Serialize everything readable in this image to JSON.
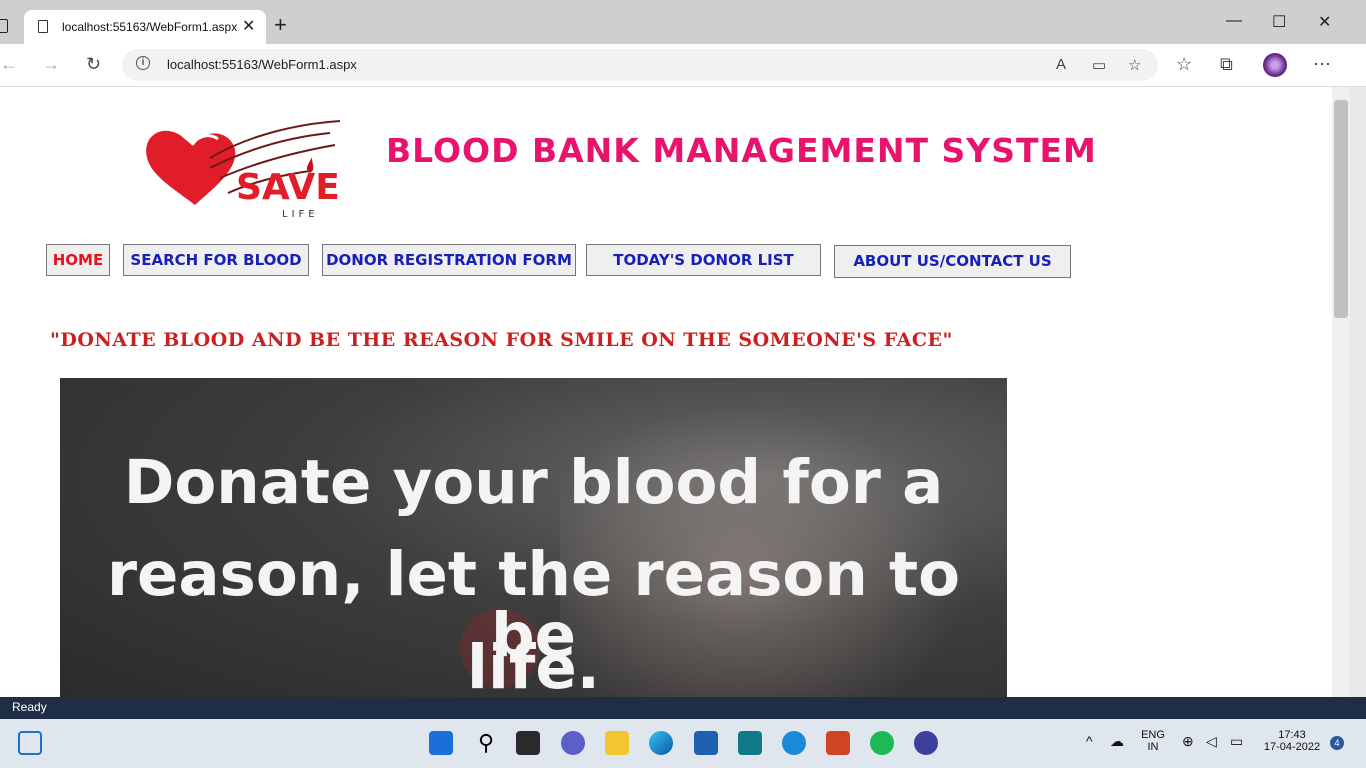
{
  "browser": {
    "tab_title": "localhost:55163/WebForm1.aspx",
    "tab_close": "✕",
    "new_tab": "+",
    "url": "localhost:55163/WebForm1.aspx",
    "window_controls": [
      "—",
      "☐",
      "✕"
    ]
  },
  "site": {
    "logo_text": "SAVE",
    "logo_subtext": "LIFE",
    "title": "BLOOD BANK MANAGEMENT SYSTEM",
    "menu": [
      {
        "label": "HOME",
        "color": "#e8131f"
      },
      {
        "label": "SEARCH FOR BLOOD",
        "color": "#1720b8"
      },
      {
        "label": "DONOR REGISTRATION FORM",
        "color": "#1720b8"
      },
      {
        "label": "TODAY'S DONOR LIST",
        "color": "#1720b8"
      },
      {
        "label": "ABOUT US/CONTACT US",
        "color": "#1720b8"
      }
    ],
    "tagline": "\"DONATE BLOOD AND BE THE REASON FOR SMILE ON THE SOMEONE'S FACE\"",
    "banner_lines": [
      "Donate your blood for a",
      "reason, let the reason to be",
      "life."
    ]
  },
  "status": {
    "text": "Ready"
  },
  "taskbar": {
    "lang": "ENG",
    "region": "IN",
    "time": "17:43",
    "date": "17-04-2022",
    "notifications": "4"
  },
  "colors": {
    "accent_title": "#e8136d",
    "tagline": "#cc1f1f",
    "menu_text": "#1720b8",
    "home_text": "#e8131f"
  }
}
